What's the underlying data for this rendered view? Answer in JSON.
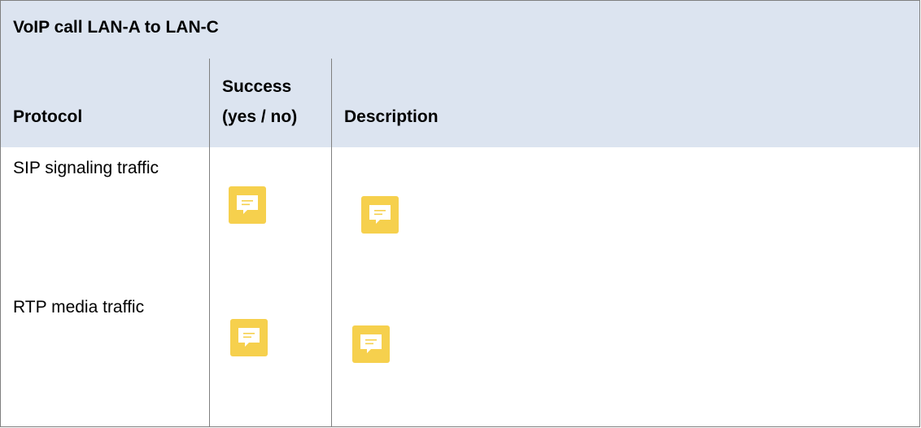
{
  "table": {
    "title": "VoIP call LAN-A to LAN-C",
    "headers": {
      "protocol": "Protocol",
      "success_line1": "Success",
      "success_line2": "(yes / no)",
      "description": "Description"
    },
    "rows": [
      {
        "protocol": "SIP signaling traffic",
        "success_icon": "comment-icon",
        "description_icon": "comment-icon"
      },
      {
        "protocol": "RTP media traffic",
        "success_icon": "comment-icon",
        "description_icon": "comment-icon"
      }
    ]
  },
  "colors": {
    "header_background": "#dce4f0",
    "border": "#7f7f7f",
    "comment_icon": "#f6d04d"
  }
}
